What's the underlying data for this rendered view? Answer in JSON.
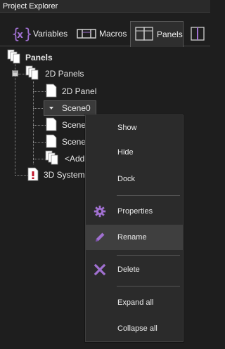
{
  "window": {
    "title": "Project Explorer"
  },
  "tabs": [
    {
      "label": "Variables",
      "icon": "variables-icon"
    },
    {
      "label": "Macros",
      "icon": "macros-icon"
    },
    {
      "label": "Panels",
      "icon": "panels-icon",
      "active": true
    },
    {
      "label": "",
      "icon": "more-tab-icon"
    }
  ],
  "tree": {
    "root": {
      "label": "Panels",
      "icon": "panels-folder-icon"
    },
    "group_2d": {
      "label": "2D Panels",
      "icon": "panel-group-icon",
      "expanded": true
    },
    "items": [
      {
        "label": "2D Panel",
        "icon": "panel-doc-icon"
      },
      {
        "label": "Scene0",
        "icon": "dropdown-arrow-icon",
        "selected": true
      },
      {
        "label": "Scene",
        "icon": "panel-doc-icon"
      },
      {
        "label": "Scene",
        "icon": "panel-doc-icon"
      },
      {
        "label": "<Add",
        "icon": "add-panel-icon"
      }
    ],
    "group_3d": {
      "label": "3D System",
      "icon": "panel-warning-icon"
    }
  },
  "context_menu": {
    "items": [
      {
        "label": "Show"
      },
      {
        "label": "Hide"
      },
      {
        "label": "Dock"
      },
      {
        "label": "Properties",
        "icon": "gear-icon"
      },
      {
        "label": "Rename",
        "icon": "pencil-icon",
        "hovered": true
      },
      {
        "label": "Delete",
        "icon": "delete-x-icon"
      },
      {
        "label": "Expand all"
      },
      {
        "label": "Collapse all"
      }
    ]
  },
  "colors": {
    "accent_purple": "#a070d0",
    "background": "#1e1e1e",
    "menu_bg": "#2b2b2b",
    "hover_bg": "#3f3f3f"
  }
}
